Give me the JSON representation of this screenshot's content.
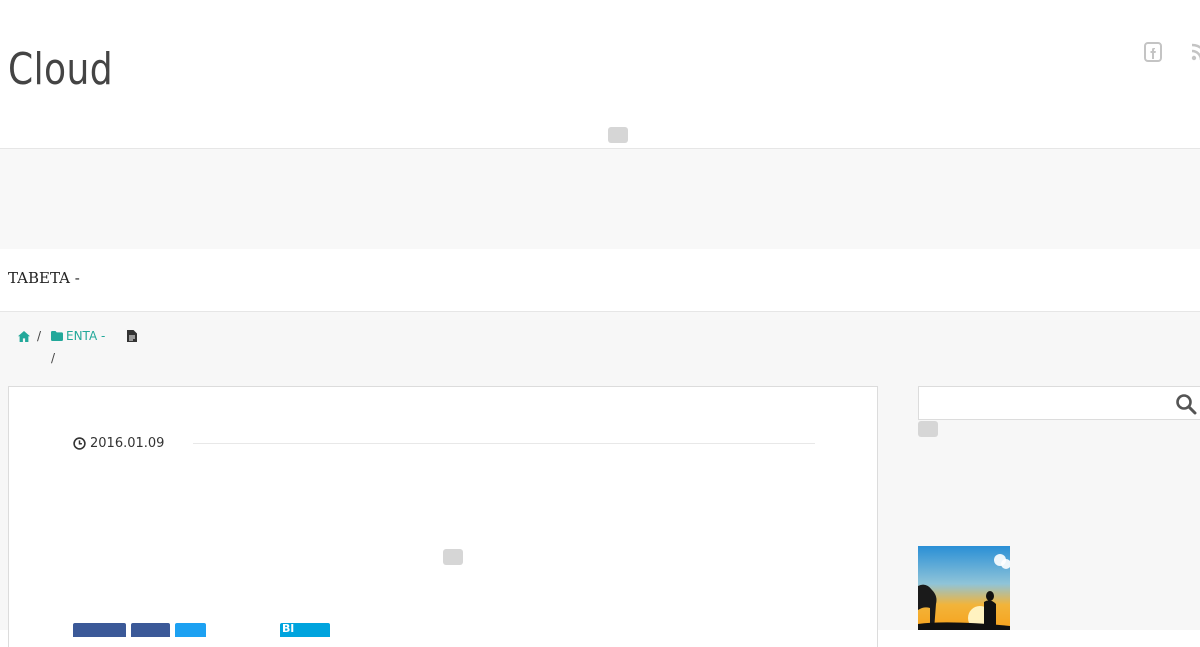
{
  "site": {
    "title": "Cloud"
  },
  "page": {
    "heading": "TABETA -"
  },
  "breadcrumb": {
    "home_icon": "home-icon",
    "category_icon": "folder-icon",
    "category": "ENTA -",
    "separator": "/",
    "post_icon": "file-icon"
  },
  "post": {
    "date_icon": "clock-icon",
    "date": "2016.01.09"
  },
  "share": {
    "buttons": [
      {
        "name": "facebook",
        "color": "#3b5998"
      },
      {
        "name": "google-plus",
        "color": "#3b5998"
      },
      {
        "name": "twitter",
        "color": "#1da1f2"
      },
      {
        "name": "hatena-bookmark",
        "color": "#00a4de",
        "label": "Bl"
      }
    ]
  },
  "colors": {
    "accent": "#22a89a",
    "band_bg": "#f8f8f8",
    "border": "#e6e6e6"
  }
}
